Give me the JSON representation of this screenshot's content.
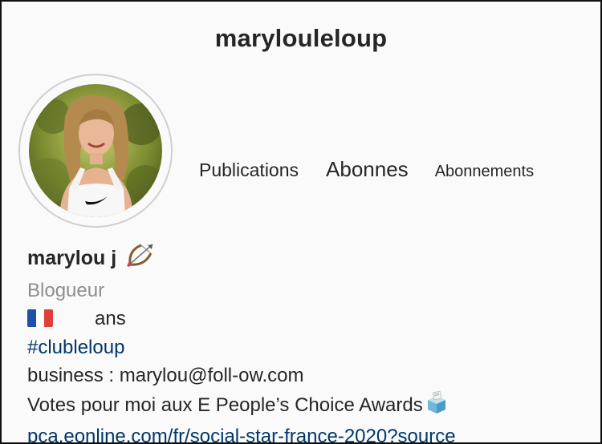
{
  "header": {
    "username": "maryloule​loup"
  },
  "profile": {
    "display_name": "marylou j",
    "name_emoji_icon": "bow-and-arrow-icon",
    "category": "Blogueur",
    "flag_icon": "france-flag-icon",
    "age_text": "ans",
    "hashtag": "#clubleloup",
    "business": "business : marylou@foll-ow.com",
    "votes_text": "Votes pour moi aux E People’s Choice Awards",
    "votes_icon": "ballot-box-icon",
    "link": "pca.eonline.com/fr/social-star-france-2020?source"
  },
  "stats": {
    "publications_label": "Publications",
    "abonnes_label": "Abonnes",
    "abonnements_label": "Abonnements"
  },
  "colors": {
    "link": "#00376b",
    "muted": "#8e8e8e",
    "text": "#262626",
    "flag_blue": "#1f4fa8",
    "flag_white": "#ffffff",
    "flag_red": "#e0403a"
  }
}
